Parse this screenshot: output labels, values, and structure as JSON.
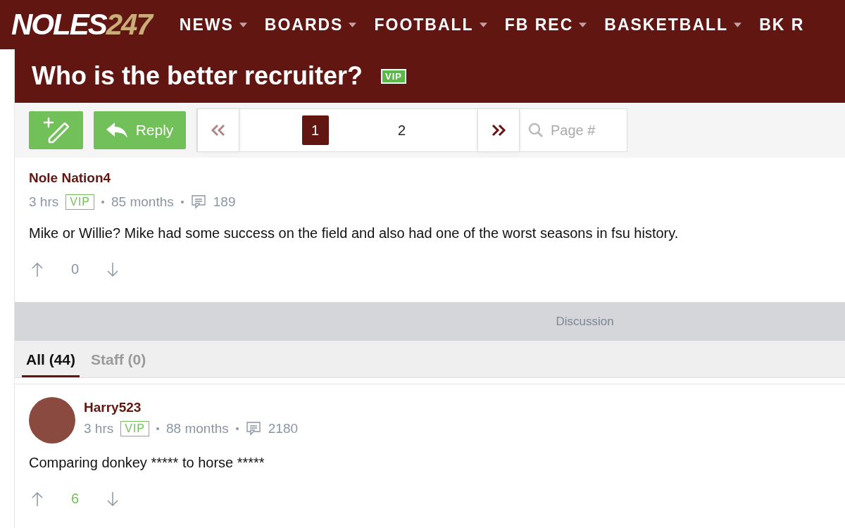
{
  "header": {
    "logo": {
      "main": "NOLES",
      "accent": "247"
    },
    "nav": [
      {
        "label": "NEWS",
        "has_menu": true
      },
      {
        "label": "BOARDS",
        "has_menu": true
      },
      {
        "label": "FOOTBALL",
        "has_menu": true
      },
      {
        "label": "FB REC",
        "has_menu": true
      },
      {
        "label": "BASKETBALL",
        "has_menu": true
      },
      {
        "label": "BK R",
        "has_menu": false
      }
    ]
  },
  "thread": {
    "title": "Who is the better recruiter?",
    "badge": "VIP"
  },
  "toolbar": {
    "reply": "Reply",
    "pages": [
      {
        "label": "1",
        "selected": true
      },
      {
        "label": "2",
        "selected": false
      }
    ],
    "page_search": {
      "placeholder": "Page #"
    }
  },
  "post": {
    "author": "Nole Nation4",
    "time": "3 hrs",
    "badge": "VIP",
    "tenure": "85 months",
    "post_count": "189",
    "body": "Mike or Willie? Mike had some success on the field and also had one of the worst seasons in fsu history.",
    "score": "0",
    "positive": false
  },
  "discussion": {
    "label": "Discussion",
    "tabs": [
      {
        "label": "All (44)",
        "selected": true
      },
      {
        "label": "Staff (0)",
        "selected": false
      }
    ]
  },
  "comments": [
    {
      "author": "Harry523",
      "time": "3 hrs",
      "badge": "VIP",
      "tenure": "88 months",
      "post_count": "2180",
      "body": "Comparing donkey ***** to horse *****",
      "score": "6",
      "positive": true
    }
  ]
}
